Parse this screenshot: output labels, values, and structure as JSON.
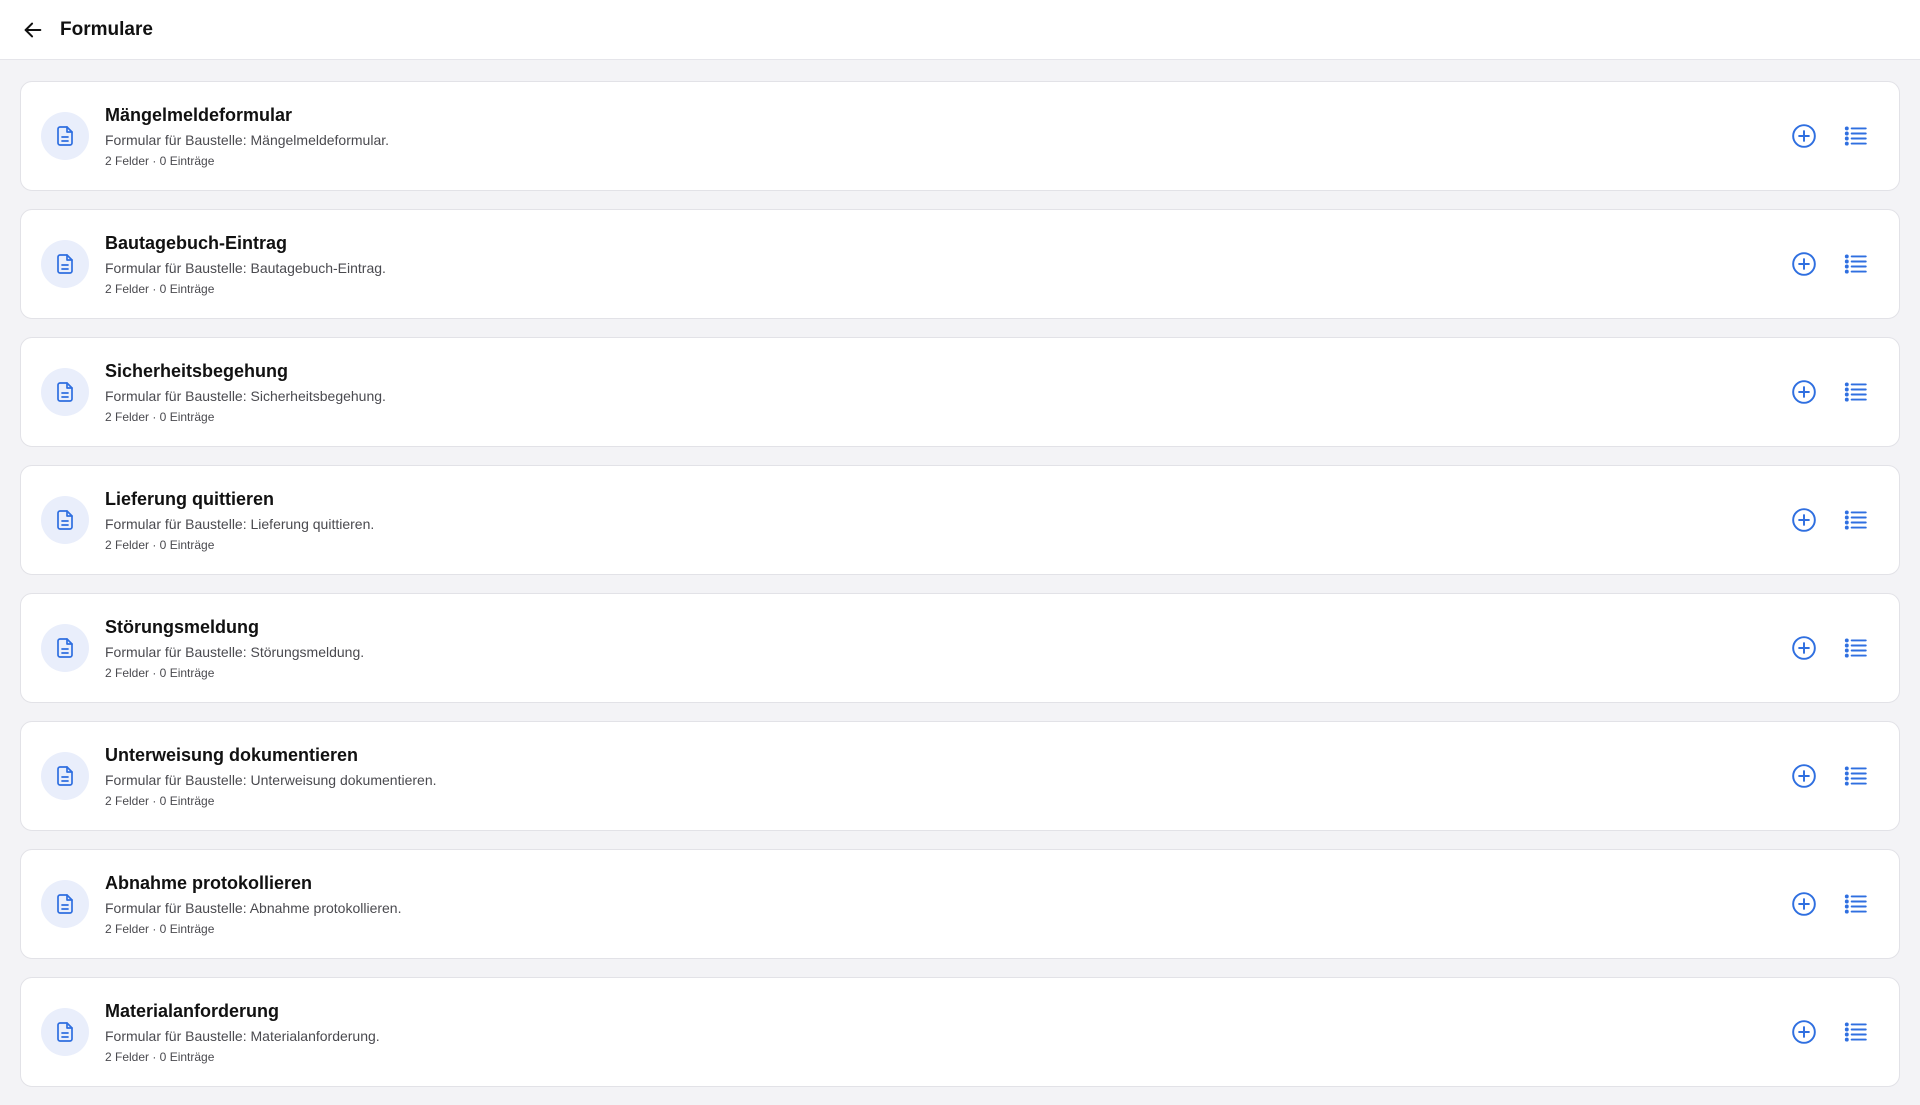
{
  "header": {
    "title": "Formulare",
    "back_icon": "arrow-left-icon"
  },
  "colors": {
    "accent": "#2f6fe0",
    "icon_bg": "#e9eefb",
    "page_bg": "#f3f3f6"
  },
  "forms": [
    {
      "title": "Mängelmeldeformular",
      "description": "Formular für Baustelle: Mängelmeldeformular.",
      "meta": "2 Felder · 0 Einträge"
    },
    {
      "title": "Bautagebuch-Eintrag",
      "description": "Formular für Baustelle: Bautagebuch-Eintrag.",
      "meta": "2 Felder · 0 Einträge"
    },
    {
      "title": "Sicherheitsbegehung",
      "description": "Formular für Baustelle: Sicherheitsbegehung.",
      "meta": "2 Felder · 0 Einträge"
    },
    {
      "title": "Lieferung quittieren",
      "description": "Formular für Baustelle: Lieferung quittieren.",
      "meta": "2 Felder · 0 Einträge"
    },
    {
      "title": "Störungsmeldung",
      "description": "Formular für Baustelle: Störungsmeldung.",
      "meta": "2 Felder · 0 Einträge"
    },
    {
      "title": "Unterweisung dokumentieren",
      "description": "Formular für Baustelle: Unterweisung dokumentieren.",
      "meta": "2 Felder · 0 Einträge"
    },
    {
      "title": "Abnahme protokollieren",
      "description": "Formular für Baustelle: Abnahme protokollieren.",
      "meta": "2 Felder · 0 Einträge"
    },
    {
      "title": "Materialanforderung",
      "description": "Formular für Baustelle: Materialanforderung.",
      "meta": "2 Felder · 0 Einträge"
    }
  ],
  "icons": {
    "form": "document-icon",
    "add": "plus-circle-icon",
    "list": "list-icon"
  }
}
